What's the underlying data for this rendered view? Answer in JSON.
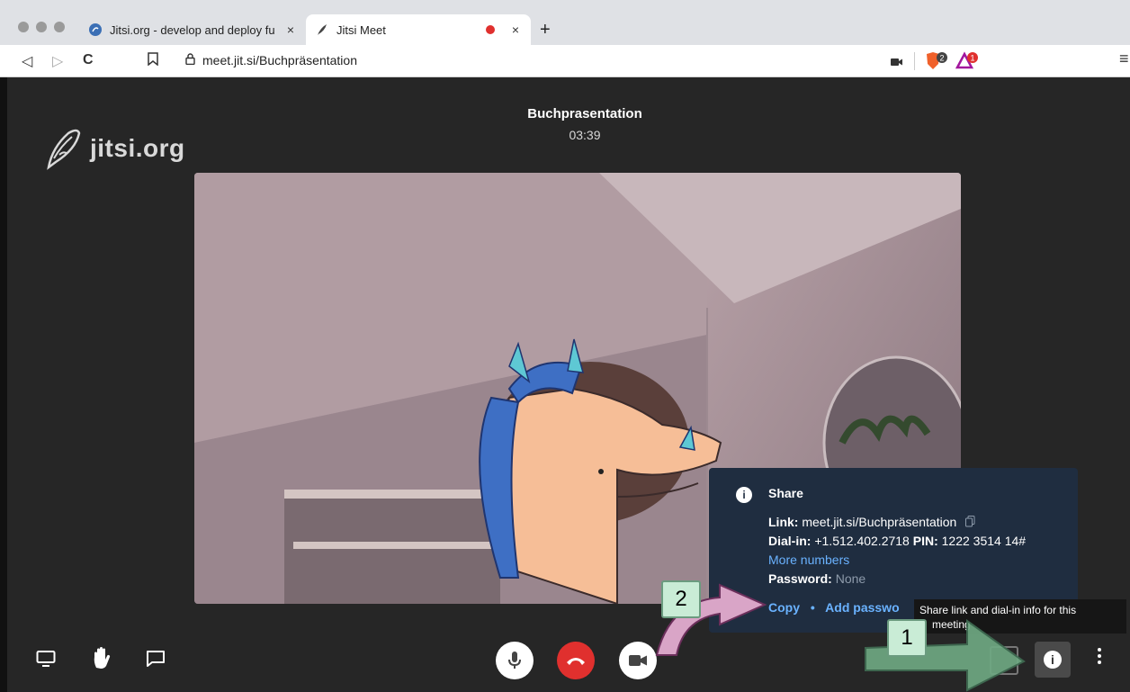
{
  "browser": {
    "tabs": [
      {
        "title": "Jitsi.org - develop and deploy fu",
        "close": "×"
      },
      {
        "title": "Jitsi Meet",
        "close": "×"
      }
    ],
    "new_tab": "+",
    "back": "◁",
    "forward": "▷",
    "reload": "C",
    "url": "meet.jit.si/Buchpräsentation",
    "brave_badge": "2",
    "alert_badge": "1",
    "menu": "≡"
  },
  "meeting": {
    "logo_text": "jitsi.org",
    "title": "Buchprasentation",
    "timer": "03:39"
  },
  "share_popup": {
    "heading": "Share",
    "link_label": "Link:",
    "link_value": "meet.jit.si/Buchpräsentation",
    "dialin_label": "Dial-in:",
    "dialin_value": "+1.512.402.2718",
    "pin_label": "PIN:",
    "pin_value": "1222 3514 14#",
    "more_numbers": "More numbers",
    "password_label": "Password:",
    "password_value": "None",
    "copy": "Copy",
    "separator": "•",
    "add_password": "Add passwo"
  },
  "tooltip": {
    "line1": "Share link and dial-in info for this",
    "line2": "meeting"
  },
  "callouts": {
    "one": "1",
    "two": "2"
  },
  "colors": {
    "popup_bg": "#1f2d40",
    "link_blue": "#6ab2ff",
    "hangup_red": "#e0302e",
    "callout_green": "#c9ecd6",
    "arrow_green": "#6ea882",
    "arrow_pink": "#d9a5c7"
  }
}
